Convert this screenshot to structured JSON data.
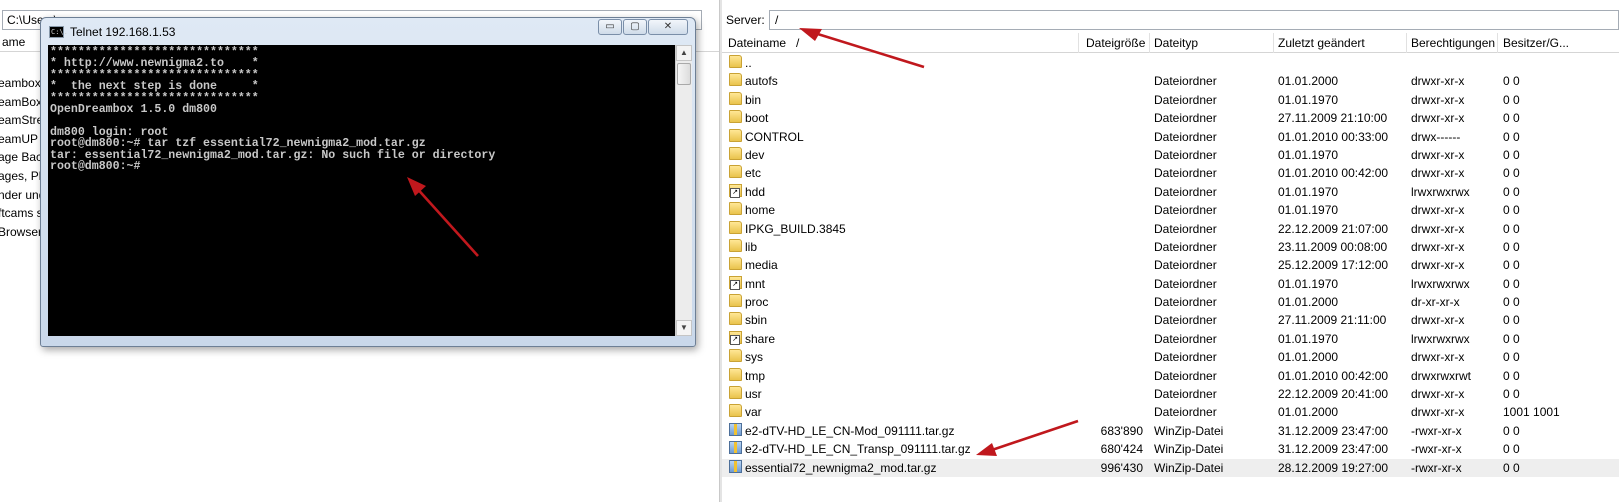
{
  "local_pane": {
    "path": "C:\\Users\\",
    "header_fragment": "ame",
    "items": [
      "eambox",
      "eamBox",
      "eamStre",
      "eamUP",
      "age Bac",
      "ages, Pl",
      "nder und",
      "ftcams s",
      "Browser"
    ]
  },
  "telnet": {
    "title": "Telnet 192.168.1.53",
    "icon_text": "C:\\.",
    "min_glyph": "▭",
    "max_glyph": "▢",
    "close_glyph": "✕",
    "lines": [
      "******************************",
      "* http://www.newnigma2.to    *",
      "******************************",
      "*  the next step is done     *",
      "******************************",
      "OpenDreambox 1.5.0 dm800",
      "",
      "dm800 login: root",
      "root@dm800:~# tar tzf essential72_newnigma2_mod.tar.gz",
      "tar: essential72_newnigma2_mod.tar.gz: No such file or directory",
      "root@dm800:~#"
    ]
  },
  "server": {
    "label": "Server:",
    "path": "/"
  },
  "remote_columns": {
    "name": "Dateiname",
    "sort": "/",
    "size": "Dateigröße",
    "type": "Dateityp",
    "modified": "Zuletzt geändert",
    "permissions": "Berechtigungen",
    "owner": "Besitzer/G..."
  },
  "remote_files": [
    {
      "name": "..",
      "size": "",
      "type": "",
      "date": "",
      "perm": "",
      "owner": "",
      "icon": "folder-icon"
    },
    {
      "name": "autofs",
      "size": "",
      "type": "Dateiordner",
      "date": "01.01.2000",
      "perm": "drwxr-xr-x",
      "owner": "0 0",
      "icon": "folder-icon"
    },
    {
      "name": "bin",
      "size": "",
      "type": "Dateiordner",
      "date": "01.01.1970",
      "perm": "drwxr-xr-x",
      "owner": "0 0",
      "icon": "folder-icon"
    },
    {
      "name": "boot",
      "size": "",
      "type": "Dateiordner",
      "date": "27.11.2009 21:10:00",
      "perm": "drwxr-xr-x",
      "owner": "0 0",
      "icon": "folder-icon"
    },
    {
      "name": "CONTROL",
      "size": "",
      "type": "Dateiordner",
      "date": "01.01.2010 00:33:00",
      "perm": "drwx------",
      "owner": "0 0",
      "icon": "folder-icon"
    },
    {
      "name": "dev",
      "size": "",
      "type": "Dateiordner",
      "date": "01.01.1970",
      "perm": "drwxr-xr-x",
      "owner": "0 0",
      "icon": "folder-icon"
    },
    {
      "name": "etc",
      "size": "",
      "type": "Dateiordner",
      "date": "01.01.2010 00:42:00",
      "perm": "drwxr-xr-x",
      "owner": "0 0",
      "icon": "folder-icon"
    },
    {
      "name": "hdd",
      "size": "",
      "type": "Dateiordner",
      "date": "01.01.1970",
      "perm": "lrwxrwxrwx",
      "owner": "0 0",
      "icon": "link-icon"
    },
    {
      "name": "home",
      "size": "",
      "type": "Dateiordner",
      "date": "01.01.1970",
      "perm": "drwxr-xr-x",
      "owner": "0 0",
      "icon": "folder-icon"
    },
    {
      "name": "IPKG_BUILD.3845",
      "size": "",
      "type": "Dateiordner",
      "date": "22.12.2009 21:07:00",
      "perm": "drwxr-xr-x",
      "owner": "0 0",
      "icon": "folder-icon"
    },
    {
      "name": "lib",
      "size": "",
      "type": "Dateiordner",
      "date": "23.11.2009 00:08:00",
      "perm": "drwxr-xr-x",
      "owner": "0 0",
      "icon": "folder-icon"
    },
    {
      "name": "media",
      "size": "",
      "type": "Dateiordner",
      "date": "25.12.2009 17:12:00",
      "perm": "drwxr-xr-x",
      "owner": "0 0",
      "icon": "folder-icon"
    },
    {
      "name": "mnt",
      "size": "",
      "type": "Dateiordner",
      "date": "01.01.1970",
      "perm": "lrwxrwxrwx",
      "owner": "0 0",
      "icon": "link-icon"
    },
    {
      "name": "proc",
      "size": "",
      "type": "Dateiordner",
      "date": "01.01.2000",
      "perm": "dr-xr-xr-x",
      "owner": "0 0",
      "icon": "folder-icon"
    },
    {
      "name": "sbin",
      "size": "",
      "type": "Dateiordner",
      "date": "27.11.2009 21:11:00",
      "perm": "drwxr-xr-x",
      "owner": "0 0",
      "icon": "folder-icon"
    },
    {
      "name": "share",
      "size": "",
      "type": "Dateiordner",
      "date": "01.01.1970",
      "perm": "lrwxrwxrwx",
      "owner": "0 0",
      "icon": "link-icon"
    },
    {
      "name": "sys",
      "size": "",
      "type": "Dateiordner",
      "date": "01.01.2000",
      "perm": "drwxr-xr-x",
      "owner": "0 0",
      "icon": "folder-icon"
    },
    {
      "name": "tmp",
      "size": "",
      "type": "Dateiordner",
      "date": "01.01.2010 00:42:00",
      "perm": "drwxrwxrwt",
      "owner": "0 0",
      "icon": "folder-icon"
    },
    {
      "name": "usr",
      "size": "",
      "type": "Dateiordner",
      "date": "22.12.2009 20:41:00",
      "perm": "drwxr-xr-x",
      "owner": "0 0",
      "icon": "folder-icon"
    },
    {
      "name": "var",
      "size": "",
      "type": "Dateiordner",
      "date": "01.01.2000",
      "perm": "drwxr-xr-x",
      "owner": "1001 1001",
      "icon": "folder-icon"
    },
    {
      "name": "e2-dTV-HD_LE_CN-Mod_091111.tar.gz",
      "size": "683'890",
      "type": "WinZip-Datei",
      "date": "31.12.2009 23:47:00",
      "perm": "-rwxr-xr-x",
      "owner": "0 0",
      "icon": "archive-icon"
    },
    {
      "name": "e2-dTV-HD_LE_CN_Transp_091111.tar.gz",
      "size": "680'424",
      "type": "WinZip-Datei",
      "date": "31.12.2009 23:47:00",
      "perm": "-rwxr-xr-x",
      "owner": "0 0",
      "icon": "archive-icon"
    },
    {
      "name": "essential72_newnigma2_mod.tar.gz",
      "size": "996'430",
      "type": "WinZip-Datei",
      "date": "28.12.2009 19:27:00",
      "perm": "-rwxr-xr-x",
      "owner": "0 0",
      "icon": "archive-icon",
      "selected": true
    }
  ],
  "colors": {
    "annotation_arrow": "#c0181d",
    "console_bg": "#000000",
    "console_text": "#c8c8c8",
    "selected_row": "#eeeeee"
  }
}
